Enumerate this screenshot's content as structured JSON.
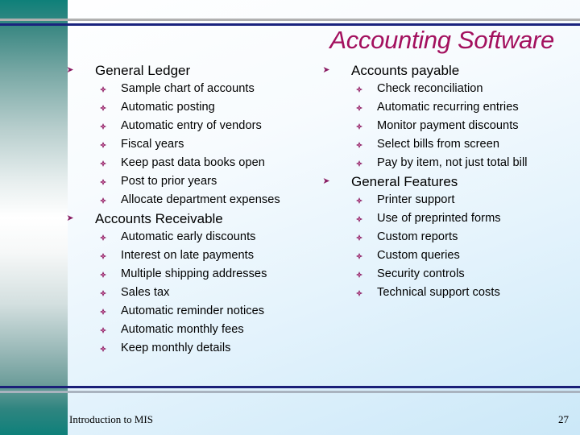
{
  "slide": {
    "title": "Accounting Software",
    "footer_text": "Introduction to MIS",
    "page_number": "27",
    "colors": {
      "title": "#a3105e",
      "bullet": "#8a1d63",
      "sidebar_teal": "#0e8079",
      "rule_navy": "#1a237e",
      "rule_gray": "#b0b0b0",
      "background_tint": "#cbe8f8"
    }
  },
  "sections": {
    "general_ledger": {
      "heading": "General Ledger",
      "items": [
        "Sample chart of accounts",
        "Automatic posting",
        "Automatic entry of vendors",
        "Fiscal years",
        "Keep past data books open",
        "Post to prior years",
        "Allocate department expenses"
      ]
    },
    "accounts_receivable": {
      "heading": "Accounts Receivable",
      "items": [
        "Automatic early discounts",
        "Interest on late payments",
        "Multiple shipping addresses",
        "Sales tax",
        "Automatic reminder notices",
        "Automatic monthly fees",
        "Keep monthly details"
      ]
    },
    "accounts_payable": {
      "heading": "Accounts payable",
      "items": [
        "Check reconciliation",
        "Automatic recurring entries",
        "Monitor payment discounts",
        "Select bills from screen",
        "Pay by item, not just total bill"
      ]
    },
    "general_features": {
      "heading": "General Features",
      "items": [
        "Printer support",
        "Use of preprinted forms",
        "Custom reports",
        "Custom queries",
        "Security controls",
        "Technical support costs"
      ]
    }
  },
  "icons": {
    "section_bullet": "arrow-bullet-icon",
    "item_bullet": "diamond-bullet-icon"
  }
}
